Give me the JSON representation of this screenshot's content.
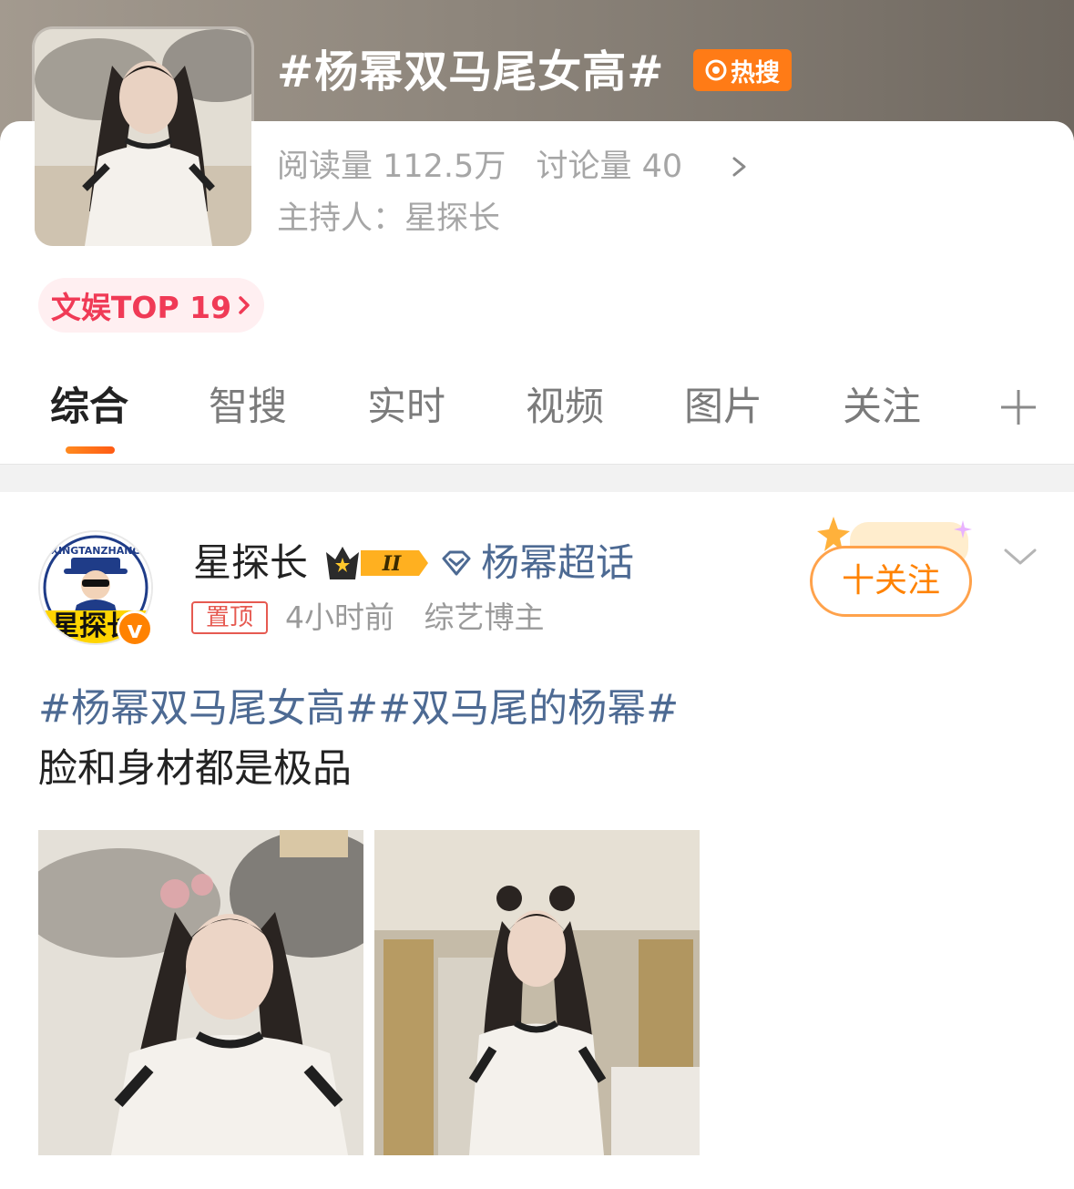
{
  "topic": {
    "title": "#杨幂双马尾女高#",
    "hot_badge": "热搜",
    "stats": {
      "reads": "阅读量 112.5万",
      "discussions": "讨论量 40"
    },
    "host": "主持人：星探长",
    "rank": "文娱TOP 19"
  },
  "tabs": [
    {
      "label": "综合",
      "active": true
    },
    {
      "label": "智搜"
    },
    {
      "label": "实时"
    },
    {
      "label": "视频"
    },
    {
      "label": "图片"
    },
    {
      "label": "关注"
    }
  ],
  "post": {
    "author": "星探长",
    "avatar_text": "星探长",
    "avatar_ring_text": "XINGTANZHANG",
    "vip_level": "II",
    "supertopic": "杨幂超话",
    "pinned": "置顶",
    "time": "4小时前",
    "author_role": "综艺博主",
    "follow_label": "十关注",
    "text_topic_1": "#杨幂双马尾女高#",
    "text_topic_2": "#双马尾的杨幂#",
    "text_body": "脸和身材都是极品"
  },
  "colors": {
    "accent": "#ff8200",
    "topic_link": "#4d6a93",
    "rank_red": "#f03a56",
    "hot_orange": "#ff7b16"
  },
  "icons": [
    "hot-search-icon",
    "chevron-right-icon",
    "add-tab-icon",
    "diamond-icon",
    "chevron-down-icon",
    "verified-icon",
    "crown-icon"
  ]
}
